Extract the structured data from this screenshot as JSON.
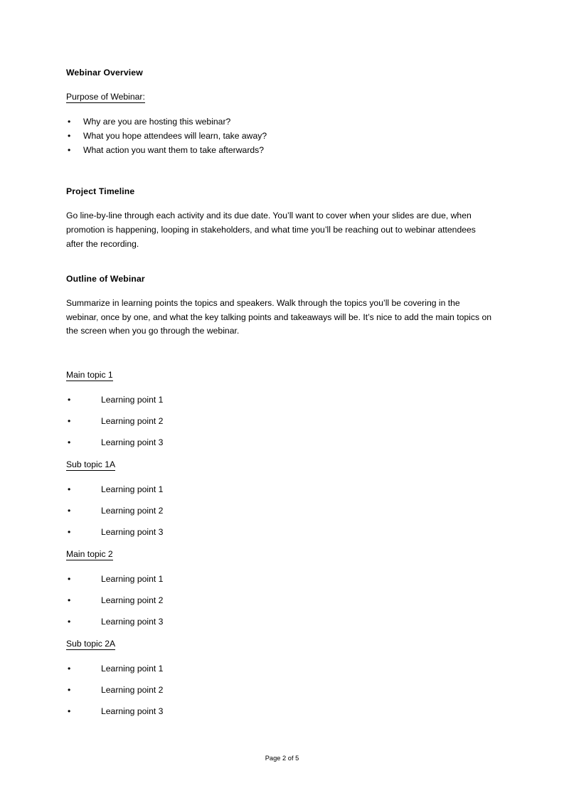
{
  "document": {
    "sections": {
      "webinar_overview": {
        "heading": "Webinar Overview",
        "purpose_label": "Purpose of Webinar: ",
        "bullets": [
          "Why are you are hosting this webinar?",
          "What you hope attendees will learn, take away?",
          "What action you want them to take afterwards?"
        ]
      },
      "project_timeline": {
        "heading": "Project Timeline",
        "paragraph": "Go line-by-line through each activity and its due date. You’ll want to cover when your slides are due, when promotion is happening, looping in stakeholders, and what time you’ll be reaching out to webinar attendees after the recording."
      },
      "outline_of_webinar": {
        "heading": "Outline of Webinar",
        "paragraph": "Summarize in learning points the topics and speakers. Walk through the topics you’ll be covering in the webinar, once by one, and what the key talking points and takeaways will be.  It’s nice to add the main topics on the screen when you go through the webinar.",
        "topics": [
          {
            "title": "Main topic 1",
            "points": [
              "Learning point 1",
              "Learning point 2",
              "Learning point 3"
            ]
          },
          {
            "title": "Sub topic 1A",
            "points": [
              "Learning point 1",
              "Learning point 2",
              "Learning point 3"
            ]
          },
          {
            "title": "Main topic 2",
            "points": [
              "Learning point 1",
              "Learning point 2",
              "Learning point 3"
            ]
          },
          {
            "title": "Sub topic 2A",
            "points": [
              "Learning point 1",
              "Learning point 2",
              "Learning point 3"
            ]
          }
        ]
      }
    },
    "bullet_glyph": "•",
    "footer": {
      "page_label": "Page 2 of 5"
    }
  }
}
